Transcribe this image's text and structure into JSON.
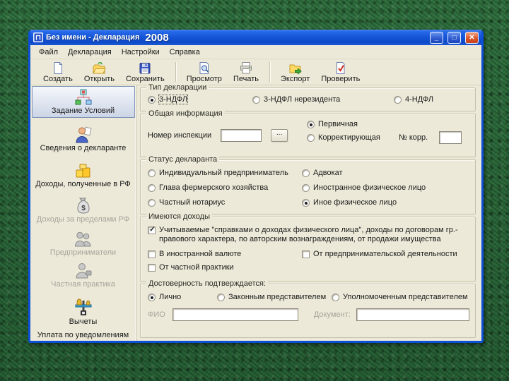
{
  "window": {
    "title": "Без имени - Декларация",
    "year": "2008",
    "controls": {
      "minimize": "_",
      "maximize": "□",
      "close": "✕"
    }
  },
  "menu": {
    "items": [
      {
        "label": "Файл"
      },
      {
        "label": "Декларация"
      },
      {
        "label": "Настройки"
      },
      {
        "label": "Справка"
      }
    ]
  },
  "toolbar": {
    "buttons": [
      {
        "label": "Создать",
        "icon": "new-document-icon"
      },
      {
        "label": "Открыть",
        "icon": "open-folder-icon"
      },
      {
        "label": "Сохранить",
        "icon": "save-icon"
      },
      {
        "label": "Просмотр",
        "icon": "preview-icon"
      },
      {
        "label": "Печать",
        "icon": "print-icon"
      },
      {
        "label": "Экспорт",
        "icon": "export-icon"
      },
      {
        "label": "Проверить",
        "icon": "verify-icon"
      }
    ]
  },
  "sidebar": {
    "items": [
      {
        "label": "Задание Условий",
        "icon": "conditions-icon",
        "state": "selected"
      },
      {
        "label": "Сведения о декларанте",
        "icon": "declarant-icon",
        "state": "enabled"
      },
      {
        "label": "Доходы, полученные в РФ",
        "icon": "income-rf-icon",
        "state": "enabled"
      },
      {
        "label": "Доходы за пределами РФ",
        "icon": "income-abroad-icon",
        "state": "disabled"
      },
      {
        "label": "Предприниматели",
        "icon": "entrepreneurs-icon",
        "state": "disabled"
      },
      {
        "label": "Частная практика",
        "icon": "private-practice-icon",
        "state": "disabled"
      },
      {
        "label": "Вычеты",
        "icon": "deductions-icon",
        "state": "enabled"
      },
      {
        "label": "Уплата по уведомлениям",
        "icon": "none",
        "state": "enabled"
      }
    ]
  },
  "declaration_type": {
    "legend": "Тип декларации",
    "options": [
      {
        "label": "3-НДФЛ",
        "selected": true
      },
      {
        "label": "3-НДФЛ нерезидента",
        "selected": false
      },
      {
        "label": "4-НДФЛ",
        "selected": false
      }
    ]
  },
  "general_info": {
    "legend": "Общая информация",
    "inspection_label": "Номер инспекции",
    "inspection_value": "",
    "browse_label": "...",
    "options": [
      {
        "label": "Первичная",
        "selected": true
      },
      {
        "label": "Корректирующая",
        "selected": false
      }
    ],
    "corr_label": "№ корр.",
    "corr_value": ""
  },
  "declarant_status": {
    "legend": "Статус декларанта",
    "options": [
      {
        "label": "Индивидуальный предприниматель",
        "selected": false
      },
      {
        "label": "Глава фермерского хозяйства",
        "selected": false
      },
      {
        "label": "Частный нотариус",
        "selected": false
      },
      {
        "label": "Адвокат",
        "selected": false
      },
      {
        "label": "Иностранное физическое лицо",
        "selected": false
      },
      {
        "label": "Иное физическое лицо",
        "selected": true
      }
    ]
  },
  "income_types": {
    "legend": "Имеются доходы",
    "options": [
      {
        "label": "Учитываемые \"справками о доходах физического лица\", доходы по договорам гр.-правового характера, по авторским вознаграждениям, от продажи имущества",
        "checked": true
      },
      {
        "label": "В иностранной валюте",
        "checked": false
      },
      {
        "label": "От предпринимательской деятельности",
        "checked": false
      },
      {
        "label": "От частной практики",
        "checked": false
      }
    ]
  },
  "confirmation": {
    "legend": "Достоверность подтверждается:",
    "options": [
      {
        "label": "Лично",
        "selected": true
      },
      {
        "label": "Законным представителем",
        "selected": false
      },
      {
        "label": "Уполномоченным представителем",
        "selected": false
      }
    ],
    "fio_label": "ФИО",
    "fio_value": "",
    "document_label": "Документ:",
    "document_value": ""
  },
  "colors": {
    "titlebar_blue": "#1557d8",
    "window_border": "#0c50d8",
    "client_beige": "#ece9d8",
    "background_green": "#2a6839",
    "close_button": "#da5226"
  }
}
